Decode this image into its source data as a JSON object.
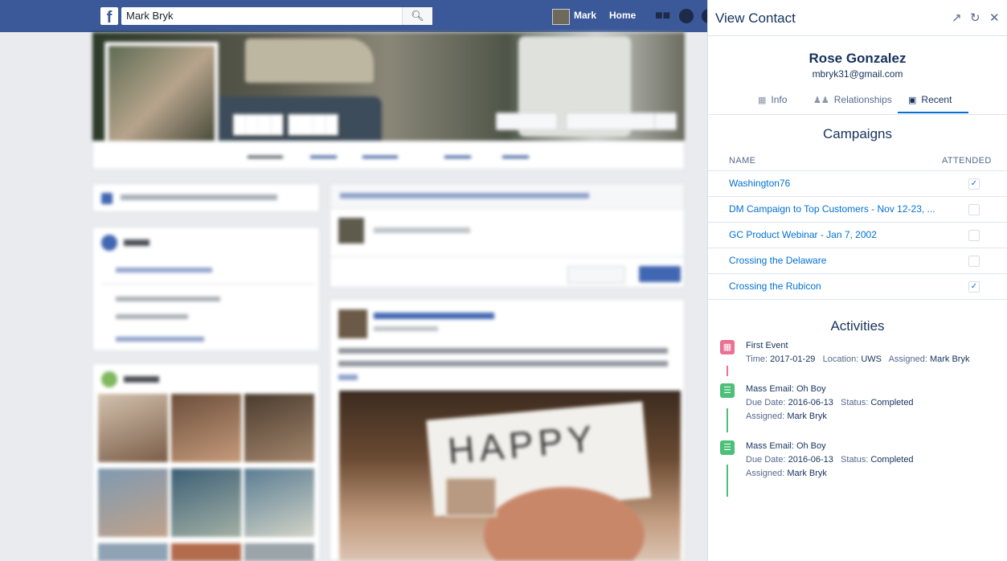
{
  "facebook": {
    "logo": "f",
    "search_value": "Mark Bryk",
    "search_icon": "search-icon",
    "user_name": "Mark",
    "home_label": "Home"
  },
  "panel": {
    "title": "View Contact",
    "icons": [
      "popout-icon",
      "refresh-icon",
      "close-icon"
    ],
    "contact": {
      "name": "Rose Gonzalez",
      "email": "mbryk31@gmail.com"
    },
    "tabs": [
      {
        "label": "Info",
        "icon": "contact-card-icon"
      },
      {
        "label": "Relationships",
        "icon": "people-icon"
      },
      {
        "label": "Recent",
        "icon": "calendar-icon",
        "active": true
      }
    ],
    "campaigns": {
      "title": "Campaigns",
      "col_name": "NAME",
      "col_attended": "ATTENDED",
      "rows": [
        {
          "name": "Washington76",
          "attended": true
        },
        {
          "name": "DM Campaign to Top Customers - Nov 12-23, ...",
          "attended": false
        },
        {
          "name": "GC Product Webinar - Jan 7, 2002",
          "attended": false
        },
        {
          "name": "Crossing the Delaware",
          "attended": false
        },
        {
          "name": "Crossing the Rubicon",
          "attended": true
        }
      ]
    },
    "activities": {
      "title": "Activities",
      "items": [
        {
          "type": "event",
          "color": "#eb7092",
          "title": "First Event",
          "time_label": "Time:",
          "time": "2017-01-29",
          "location_label": "Location:",
          "location": "UWS",
          "assigned_label": "Assigned:",
          "assigned": "Mark Bryk"
        },
        {
          "type": "task",
          "color": "#4bc076",
          "title": "Mass Email: Oh Boy",
          "due_label": "Due Date:",
          "due": "2016-06-13",
          "status_label": "Status:",
          "status": "Completed",
          "assigned_label": "Assigned:",
          "assigned": "Mark Bryk"
        },
        {
          "type": "task",
          "color": "#4bc076",
          "title": "Mass Email: Oh Boy",
          "due_label": "Due Date:",
          "due": "2016-06-13",
          "status_label": "Status:",
          "status": "Completed",
          "assigned_label": "Assigned:",
          "assigned": "Mark Bryk"
        }
      ]
    }
  }
}
